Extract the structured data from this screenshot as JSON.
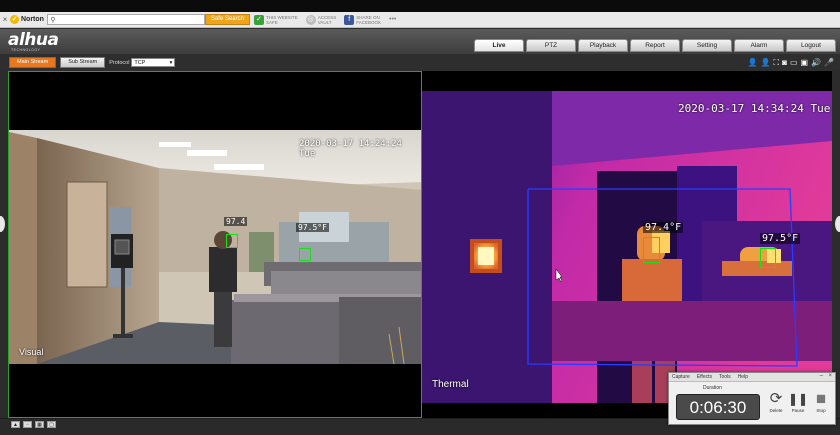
{
  "browser": {
    "close_glyph": "×",
    "norton_label": "Norton",
    "search_placeholder": "",
    "safe_search_label": "Safe Search",
    "items": [
      {
        "icon": "shield-check-icon",
        "line1": "THIS WEBSITE",
        "line2": "SAFE",
        "color": "#3aa03a"
      },
      {
        "icon": "vault-icon",
        "line1": "ACCESS",
        "line2": "VAULT",
        "color": "#bcbcbc"
      },
      {
        "icon": "facebook-icon",
        "line1": "SHARE ON",
        "line2": "FACEBOOK",
        "color": "#3b5998"
      }
    ],
    "more_glyph": "•••"
  },
  "header": {
    "logo": "alhua",
    "logo_sub": "TECHNOLOGY",
    "nav": [
      "Live",
      "PTZ",
      "Playback",
      "Report",
      "Setting",
      "Alarm",
      "Logout"
    ],
    "active_tab": "Live"
  },
  "stream_bar": {
    "main_stream": "Main Stream",
    "sub_stream": "Sub Stream",
    "protocol_label": "Protocol",
    "protocol_value": "TCP",
    "tool_icons": [
      "person-icon",
      "person-icon",
      "fullscreen-icon",
      "snapshot-icon",
      "record-icon",
      "camera-icon",
      "audio-icon",
      "microphone-icon"
    ]
  },
  "left_pane": {
    "timestamp": "2020-03-17 14:24:24 Tue",
    "caption": "Visual",
    "temps": [
      "97.4",
      "97.5°F"
    ]
  },
  "right_pane": {
    "timestamp": "2020-03-17 14:34:24 Tue",
    "caption": "Thermal",
    "temps": [
      "97.4°F",
      "97.5°F"
    ]
  },
  "recorder": {
    "menu": [
      "Capture",
      "Effects",
      "Tools",
      "Help"
    ],
    "duration_label": "Duration",
    "time": "0:06:30",
    "buttons": [
      {
        "icon": "refresh-icon",
        "label": "Delete",
        "glyph": "⟳"
      },
      {
        "icon": "pause-icon",
        "label": "Pause",
        "glyph": "❚❚"
      },
      {
        "icon": "stop-icon",
        "label": "Stop",
        "glyph": "■"
      }
    ]
  },
  "colors": {
    "accent_orange": "#e87820",
    "face_box_green": "#18e018",
    "roi_blue": "#2a3cff"
  }
}
